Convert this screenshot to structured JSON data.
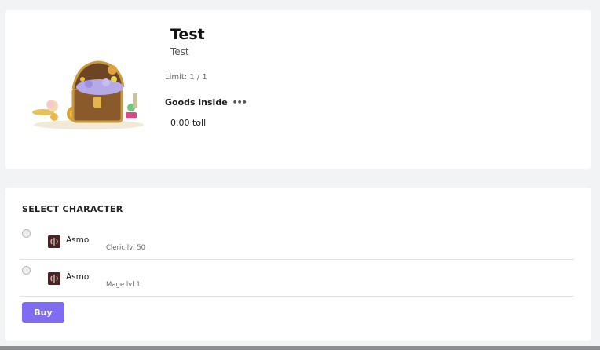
{
  "product": {
    "title": "Test",
    "subtitle": "Test",
    "limit": "Limit: 1 / 1",
    "goods_label": "Goods inside",
    "price": "0.00 toll",
    "image_icon": "treasure-chest"
  },
  "select": {
    "heading": "SELECT CHARACTER",
    "characters": [
      {
        "name": "Asmo",
        "class": "Cleric lvl 50",
        "icon": "class-emblem"
      },
      {
        "name": "Asmo",
        "class": "Mage lvl 1",
        "icon": "class-emblem"
      }
    ],
    "buy_label": "Buy"
  },
  "colors": {
    "accent": "#7f6cf0",
    "background": "#f2f3f5",
    "card": "#ffffff"
  }
}
